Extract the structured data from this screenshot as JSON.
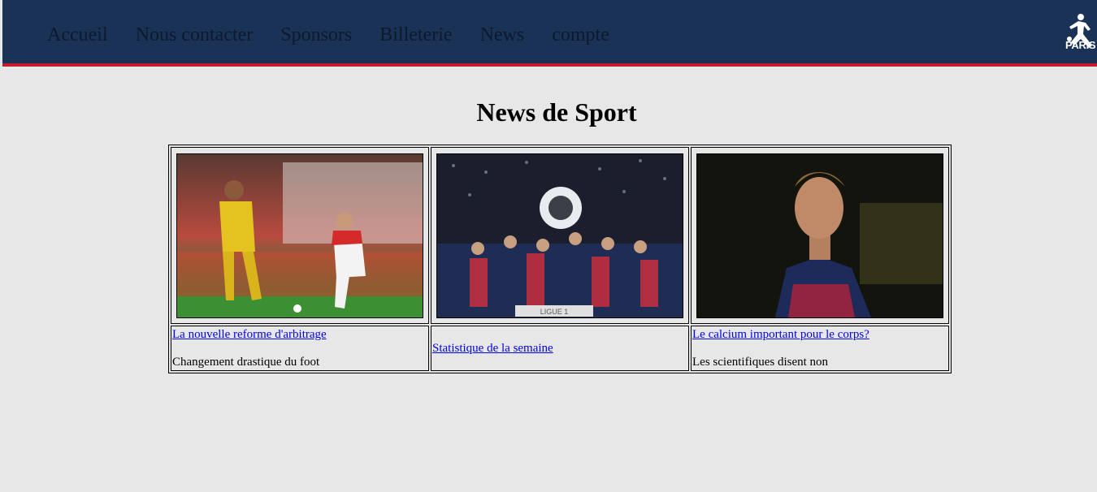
{
  "nav": {
    "items": [
      {
        "label": "Accueil"
      },
      {
        "label": "Nous contacter"
      },
      {
        "label": "Sponsors"
      },
      {
        "label": "Billeterie"
      },
      {
        "label": "News"
      },
      {
        "label": "compte"
      }
    ],
    "logo_text": "PARIS"
  },
  "main": {
    "title": "News de Sport"
  },
  "news": [
    {
      "image_alt": "football-match-photo",
      "link": "La nouvelle reforme d'arbitrage",
      "description": "Changement drastique du foot"
    },
    {
      "image_alt": "trophy-celebration-photo",
      "link": "Statistique de la semaine",
      "description": ""
    },
    {
      "image_alt": "player-portrait-photo",
      "link": "Le calcium important pour le corps?",
      "description": "Les scientifiques disent non"
    }
  ],
  "colors": {
    "nav_bg": "#1a3255",
    "nav_border": "#c51c2c",
    "page_bg": "#e7e7e7",
    "link": "#0000ee"
  }
}
